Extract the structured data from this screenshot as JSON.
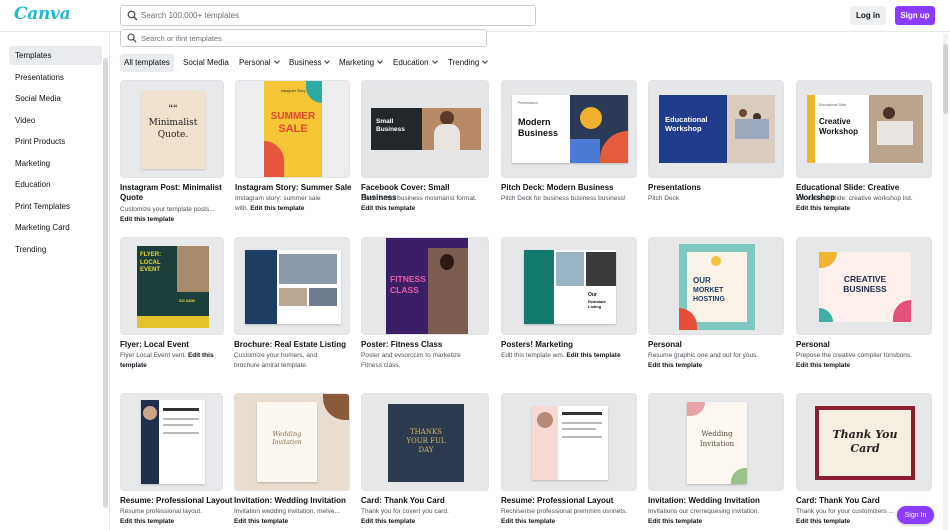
{
  "brand": {
    "logo": "Canva",
    "color": "#22b8cf",
    "accent": "#8b3dff"
  },
  "header": {
    "search_placeholder": "Search 100,000+ templates",
    "login_label": "Log in",
    "signup_label": "Sign up"
  },
  "sidebar": {
    "items": [
      {
        "label": "Templates",
        "active": true
      },
      {
        "label": "Presentations"
      },
      {
        "label": "Social Media"
      },
      {
        "label": "Video"
      },
      {
        "label": "Print Products"
      },
      {
        "label": "Marketing"
      },
      {
        "label": "Education"
      },
      {
        "label": "Print Templates"
      },
      {
        "label": "Marketing Card"
      },
      {
        "label": "Trending"
      }
    ]
  },
  "subsearch": {
    "placeholder": "Search or ifint templates"
  },
  "filters": [
    {
      "label": "All templates",
      "active": true
    },
    {
      "label": "Social Media"
    },
    {
      "label": "Personal",
      "dropdown": true
    },
    {
      "label": "Business",
      "dropdown": true
    },
    {
      "label": "Marketing",
      "dropdown": true
    },
    {
      "label": "Education",
      "dropdown": true
    },
    {
      "label": "Trending",
      "dropdown": true
    }
  ],
  "cards": [
    {
      "title": "Instagram Post: Minimalist Quote",
      "desc": "Customize your template posts...",
      "edit": "Edit this template",
      "thumb": {
        "main": "Minimalist",
        "sub": "Quote.",
        "mark": "““"
      }
    },
    {
      "title": "Instagram Story: Summer Sale",
      "desc": "Instagram story: summer sale with.",
      "edit": "Edit this template",
      "thumb": {
        "main": "SUMMER",
        "sub": "SALE",
        "tag": "Instagram Story"
      }
    },
    {
      "title": "Facebook Cover: Small Business",
      "desc": "Cover small business mosmarist format.",
      "edit": "Edit this template",
      "thumb": {
        "main": "Small",
        "sub": "Business"
      }
    },
    {
      "title": "Pitch Deck: Modern Business",
      "desc": "Pitch Deck for business business business!",
      "edit": "",
      "thumb": {
        "main": "Modern",
        "sub": "Business",
        "tag": "Presentation"
      }
    },
    {
      "title": "Presentations",
      "desc": "Pitch Deck",
      "edit": "",
      "thumb": {
        "main": "Educational",
        "sub": "Workshop"
      }
    },
    {
      "title": "Educational Slide: Creative Workshop",
      "desc": "Educational slide: creative workshop list.",
      "edit": "Edit this template",
      "thumb": {
        "main": "Creative",
        "sub": "Workshop",
        "tag": "Educational Slide"
      }
    },
    {
      "title": "Flyer: Local Event",
      "desc": "Flyer Local Event vent.",
      "edit": "Edit this template",
      "thumb": {
        "main": "FLYER:",
        "sub": "LOCAL EVENT",
        "extra": "SO ADM"
      }
    },
    {
      "title": "Brochure: Real Estate Listing",
      "desc": "Customize your homers, and brochure amiral template.",
      "edit": "",
      "thumb": {
        "main": ""
      }
    },
    {
      "title": "Poster: Fitness Class",
      "desc": "Poster and evsorccim to marketize Fitness class.",
      "edit": "",
      "thumb": {
        "main": "FITNESS",
        "sub": "CLASS"
      }
    },
    {
      "title": "Posters! Marketing",
      "desc": "Edit this template wm.",
      "edit": "Edit this template",
      "thumb": {
        "main": "Our",
        "sub": "Realstate Listing"
      }
    },
    {
      "title": "Personal",
      "desc": "Resume graphic one and out for yous.",
      "edit": "Edit this template",
      "thumb": {
        "main": "OUR",
        "sub": "MORKET HOSTING"
      }
    },
    {
      "title": "Personal",
      "desc": "Prepose the creative complier tonsbons.",
      "edit": "Edit this template",
      "thumb": {
        "main": "CREATIVE",
        "sub": "BUSINESS"
      }
    },
    {
      "title": "Resume: Professional Layout",
      "desc": "Resume professional layout.",
      "edit": "Edit this template",
      "thumb": {
        "main": ""
      }
    },
    {
      "title": "Invitation: Wedding Invitation",
      "desc": "Invitation wedding invitation, melve...",
      "edit": "Edit this template",
      "thumb": {
        "main": "Wedding",
        "sub": "Invitation"
      }
    },
    {
      "title": "Card: Thank You Card",
      "desc": "Thank you for covert you card.",
      "edit": "Edit this template",
      "thumb": {
        "main": "THANKS",
        "sub": "YOUR FUL DAY"
      }
    },
    {
      "title": "Resume: Professional Layout",
      "desc": "Rechiserise professional premmim osnnets.",
      "edit": "Edit this template",
      "thumb": {
        "main": ""
      }
    },
    {
      "title": "Invitation: Wedding Invitation",
      "desc": "Invitations our crerrequesing invitation.",
      "edit": "Edit this template",
      "thumb": {
        "main": "Wedding",
        "sub": "Invitation"
      }
    },
    {
      "title": "Card: Thank You Card",
      "desc": "Thank you for your customizers ...",
      "edit": "Edit this template",
      "thumb": {
        "main": "Thank You",
        "sub": "Card"
      }
    }
  ],
  "fab_label": "Sign In"
}
